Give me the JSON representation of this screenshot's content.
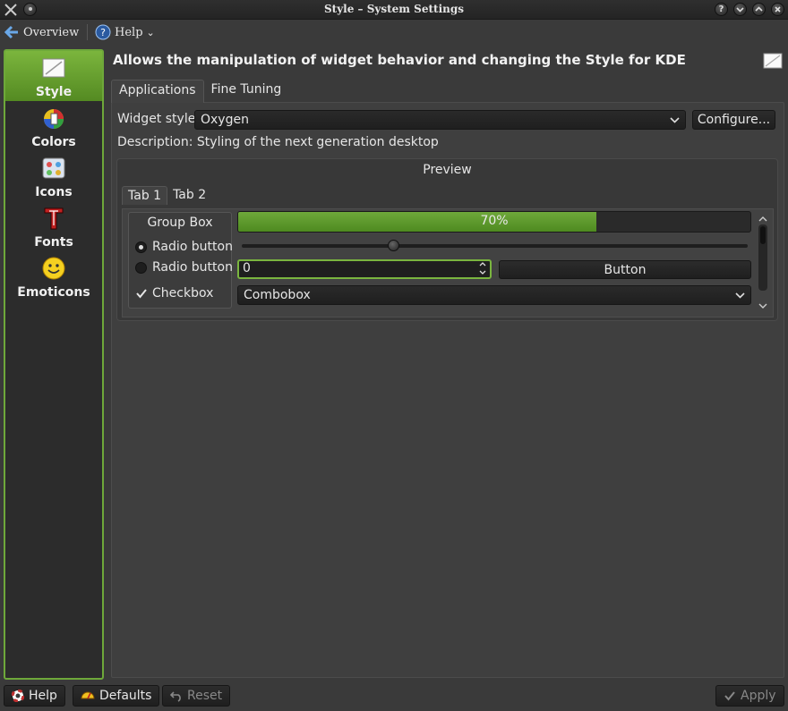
{
  "window": {
    "title": "Style – System Settings",
    "help_glyph": "?"
  },
  "toolbar": {
    "overview": "Overview",
    "help": "Help",
    "help_menu_glyph": "⌄"
  },
  "sidebar": {
    "items": [
      {
        "label": "Style",
        "icon": "style-icon",
        "active": true
      },
      {
        "label": "Colors",
        "icon": "colors-icon"
      },
      {
        "label": "Icons",
        "icon": "icons-icon"
      },
      {
        "label": "Fonts",
        "icon": "fonts-icon"
      },
      {
        "label": "Emoticons",
        "icon": "emoticons-icon"
      }
    ]
  },
  "header": {
    "text": "Allows the manipulation of widget behavior and changing the Style for KDE"
  },
  "tabs": [
    {
      "label": "Applications",
      "active": true
    },
    {
      "label": "Fine Tuning"
    }
  ],
  "widget_style": {
    "label": "Widget style:",
    "value": "Oxygen",
    "configure": "Configure..."
  },
  "description": "Description: Styling of the next generation desktop",
  "preview": {
    "title": "Preview",
    "tabs": [
      {
        "label": "Tab 1",
        "active": true
      },
      {
        "label": "Tab 2"
      }
    ],
    "group_box": "Group Box",
    "radio1": "Radio button",
    "radio2": "Radio button",
    "checkbox": "Checkbox",
    "progress_text": "70%",
    "progress_value": 0.7,
    "slider_value": 0.3,
    "spin_value": "0",
    "button": "Button",
    "combobox": "Combobox"
  },
  "bottom": {
    "help": "Help",
    "defaults": "Defaults",
    "reset": "Reset",
    "apply": "Apply"
  },
  "colors": {
    "accent": "#6ea83a",
    "progress": "#4e8a20"
  }
}
